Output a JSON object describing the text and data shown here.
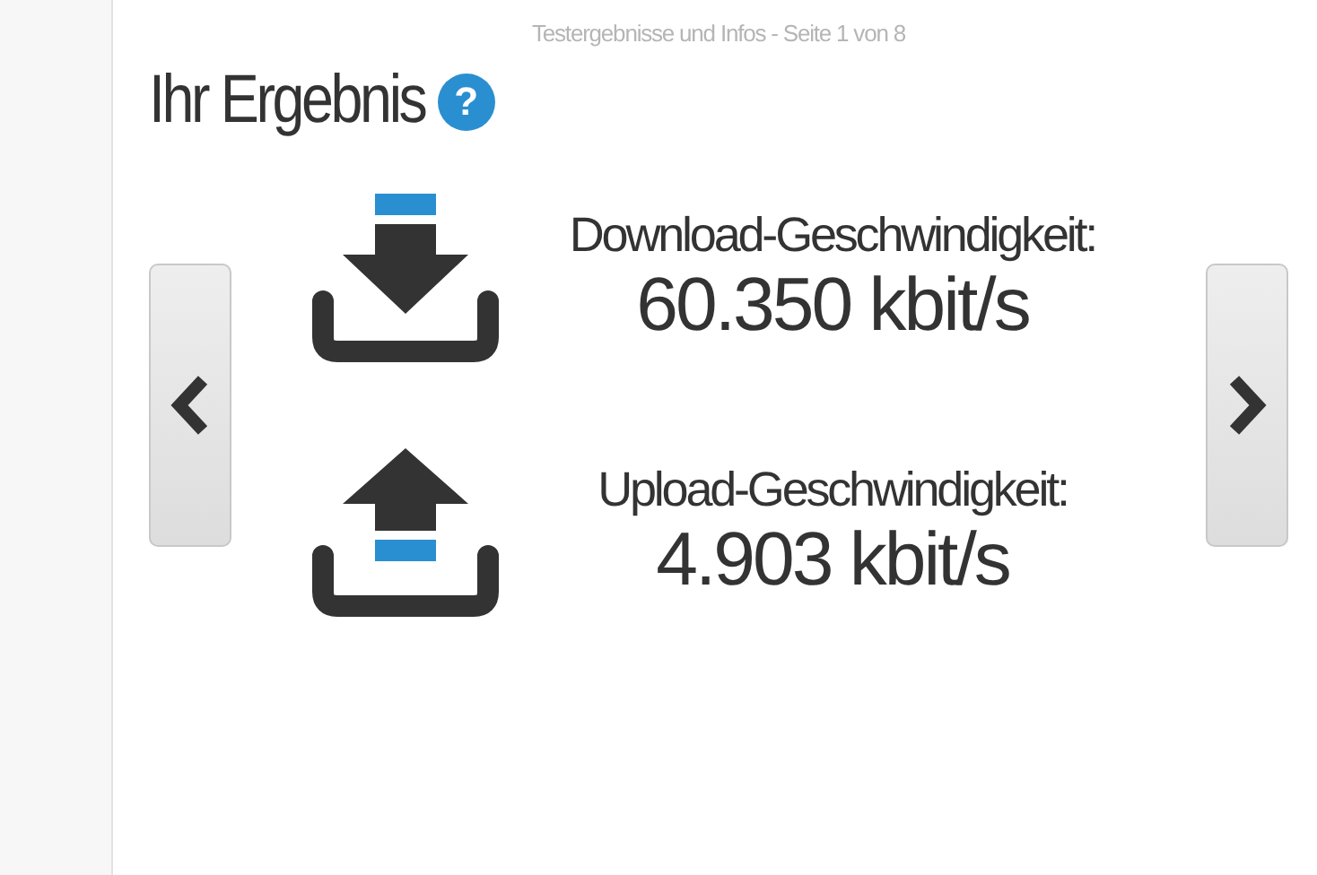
{
  "page_indicator": "Testergebnisse und Infos - Seite 1 von 8",
  "title": "Ihr Ergebnis",
  "help_icon": "?",
  "results": [
    {
      "kind": "download",
      "label": "Download-Geschwindigkeit:",
      "value": "60.350 kbit/s"
    },
    {
      "kind": "upload",
      "label": "Upload-Geschwindigkeit:",
      "value": "4.903 kbit/s"
    }
  ]
}
